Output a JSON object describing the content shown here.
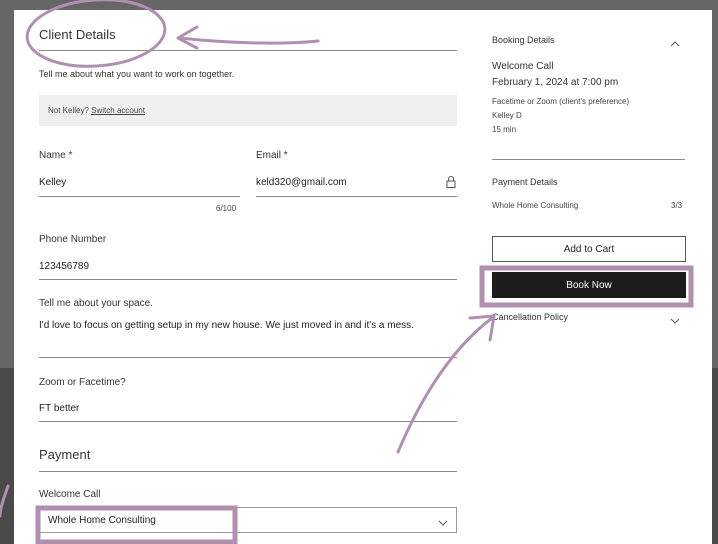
{
  "form": {
    "section_title": "Client Details",
    "intro": "Tell me about what you want to work on together.",
    "account_prefix": "Not Kelley?",
    "account_link": "Switch account",
    "name_label": "Name *",
    "name_value": "Kelley",
    "name_counter": "6/100",
    "email_label": "Email *",
    "email_value": "keld320@gmail.com",
    "phone_label": "Phone Number",
    "phone_value": "123456789",
    "space_label": "Tell me about your space.",
    "space_value": "I'd love to focus on getting setup in my new house. We just moved in and it's a mess.",
    "zoom_label": "Zoom or Facetime?",
    "zoom_value": "FT better"
  },
  "payment": {
    "title": "Payment",
    "service_label": "Welcome Call",
    "selected_option": "Whole Home Consulting"
  },
  "sidebar": {
    "booking_title": "Booking Details",
    "service": "Welcome Call",
    "datetime": "February 1, 2024 at 7:00 pm",
    "location": "Facetime or Zoom (client's preference)",
    "staff": "Kelley D",
    "duration": "15 min",
    "payment_title": "Payment Details",
    "plan_name": "Whole Home Consulting",
    "plan_count": "3/3",
    "add_to_cart": "Add to Cart",
    "book_now": "Book Now",
    "cancellation": "Cancellation Policy"
  },
  "colors": {
    "annotation": "#b08fb0",
    "primary_button": "#1c1c1c",
    "panel": "#ffffff"
  },
  "icons": [
    "chevron-up-icon",
    "chevron-down-icon",
    "lock-icon"
  ]
}
